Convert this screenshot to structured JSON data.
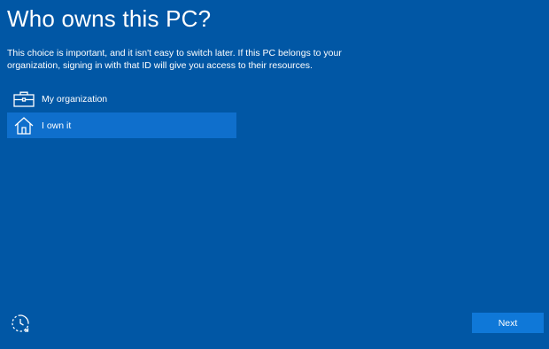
{
  "header": {
    "title": "Who owns this PC?"
  },
  "description": "This choice is important, and it isn't easy to switch later. If this PC belongs to your organization, signing in with that ID will give you access to their resources.",
  "options": [
    {
      "label": "My organization",
      "icon": "briefcase-icon",
      "selected": false
    },
    {
      "label": "I own it",
      "icon": "home-icon",
      "selected": true
    }
  ],
  "footer": {
    "accessibility_icon": "ease-of-access-icon",
    "next_label": "Next"
  },
  "colors": {
    "background": "#0157a5",
    "selected_option": "#0f6fcc",
    "next_button": "#0f78d8",
    "text": "#ffffff"
  }
}
